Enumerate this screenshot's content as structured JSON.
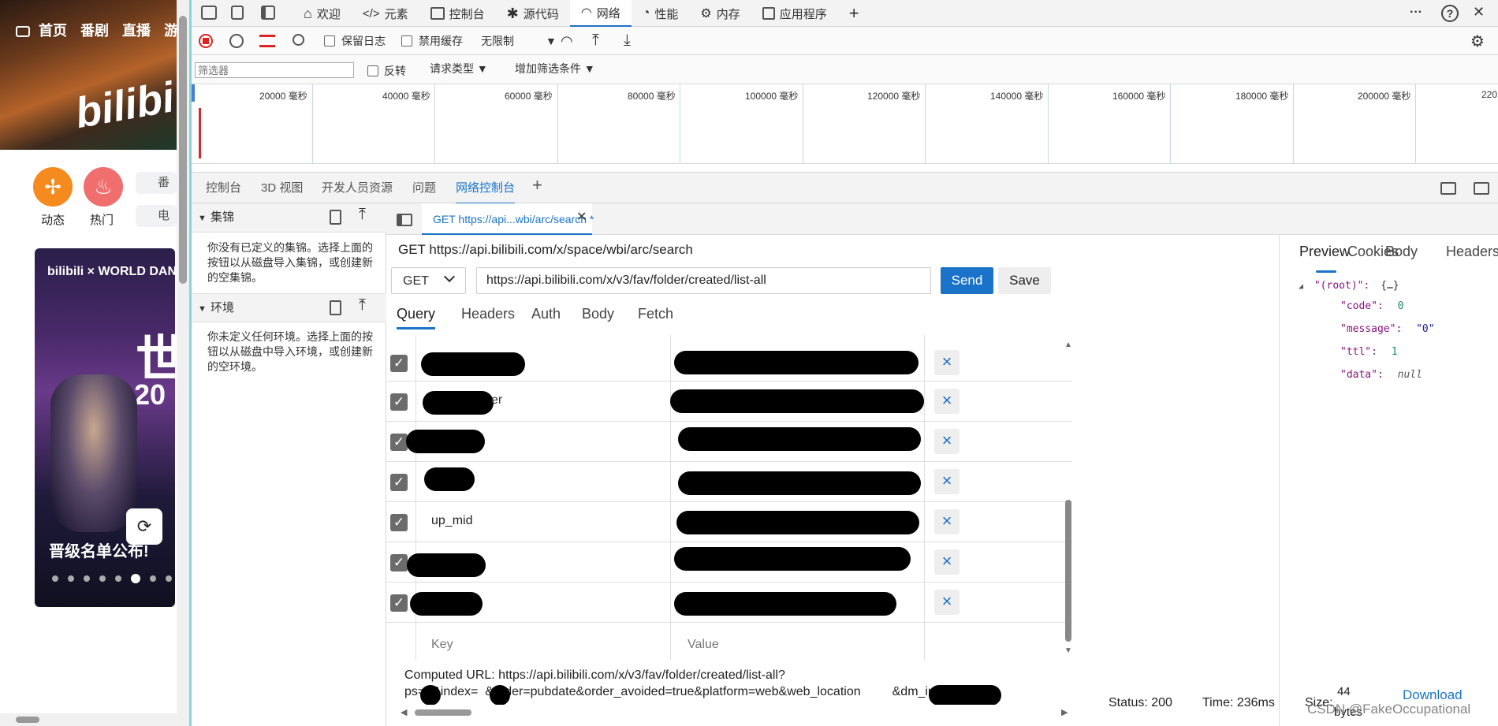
{
  "site": {
    "nav": [
      "首页",
      "番剧",
      "直播",
      "游戏"
    ],
    "logo": "bilibili",
    "quick": [
      {
        "label": "动态",
        "color": "#f58a1f"
      },
      {
        "label": "热门",
        "color": "#f06e6e"
      }
    ],
    "side_labels": [
      "番",
      "电"
    ],
    "banner_brand": "bilibili × WORLD DANCE",
    "banner_title": "晋级名单公布!",
    "banner_big": "世",
    "banner_year": "20"
  },
  "toolbar": {
    "tabs": [
      {
        "label": "欢迎",
        "icon": "home-icon"
      },
      {
        "label": "元素",
        "icon": "code-icon"
      },
      {
        "label": "控制台",
        "icon": "console-icon"
      },
      {
        "label": "源代码",
        "icon": "bug-icon"
      },
      {
        "label": "网络",
        "icon": "wifi-icon",
        "active": true
      },
      {
        "label": "性能",
        "icon": "gauge-icon"
      },
      {
        "label": "内存",
        "icon": "gear-icon"
      },
      {
        "label": "应用程序",
        "icon": "app-icon"
      }
    ],
    "add": "+",
    "more": "···",
    "help": "?",
    "close": "✕"
  },
  "network": {
    "preserve_log": "保留日志",
    "disable_cache": "禁用缓存",
    "throttle": "无限制",
    "filter_placeholder": "筛选器",
    "invert": "反转",
    "request_types": "请求类型",
    "more_filters": "增加筛选条件",
    "ticks": [
      "20000 毫秒",
      "40000 毫秒",
      "60000 毫秒",
      "80000 毫秒",
      "100000 毫秒",
      "120000 毫秒",
      "140000 毫秒",
      "160000 毫秒",
      "180000 毫秒",
      "200000 毫秒",
      "220"
    ]
  },
  "drawer": {
    "tabs": [
      "控制台",
      "3D 视图",
      "开发人员资源",
      "问题",
      "网络控制台"
    ],
    "active": "网络控制台",
    "add": "+"
  },
  "sidebar": {
    "collections_title": "集锦",
    "collections_text": "你没有已定义的集锦。选择上面的按钮以从磁盘导入集锦，或创建新的空集锦。",
    "env_title": "环境",
    "env_text": "你未定义任何环境。选择上面的按钮以从磁盘中导入环境，或创建新的空环境。"
  },
  "request": {
    "tab_label": "GET https://api...wbi/arc/search *",
    "title": "GET https://api.bilibili.com/x/space/wbi/arc/search",
    "method": "GET",
    "url": "https://api.bilibili.com/x/v3/fav/folder/created/list-all",
    "send": "Send",
    "save": "Save",
    "tabs": [
      "Query",
      "Headers",
      "Auth",
      "Body",
      "Fetch"
    ],
    "active_tab": "Query",
    "params": [
      {
        "key": "",
        "partial": "",
        "checked": true
      },
      {
        "key": "",
        "partial": "er",
        "checked": true
      },
      {
        "key": "",
        "partial": "",
        "checked": true
      },
      {
        "key": "",
        "partial": "",
        "checked": true
      },
      {
        "key": "up_mid",
        "partial": "",
        "checked": true
      },
      {
        "key": "",
        "partial": "",
        "checked": true
      },
      {
        "key": "",
        "partial": "",
        "checked": true
      }
    ],
    "key_placeholder": "Key",
    "value_placeholder": "Value",
    "computed_label": "Computed URL: https://api.bilibili.com/x/v3/fav/folder/created/list-all?",
    "computed_line2": "ps=  &index=  &order=pubdate&order_avoided=true&platform=web&web_location         &dm_img_list"
  },
  "response": {
    "tabs": [
      "Preview",
      "Body",
      "Headers",
      "Cookies"
    ],
    "active_tab": "Preview",
    "root_key": "\"(root)\":",
    "root_val": "{…}",
    "fields": [
      {
        "key": "\"code\":",
        "val": "0",
        "type": "number"
      },
      {
        "key": "\"message\":",
        "val": "\"0\"",
        "type": "string"
      },
      {
        "key": "\"ttl\":",
        "val": "1",
        "type": "number"
      },
      {
        "key": "\"data\":",
        "val": "null",
        "type": "null"
      }
    ],
    "status": "Status: 200",
    "time": "Time: 236ms",
    "size_label": "Size:",
    "size_value": "44",
    "size_unit": "bytes",
    "download": "Download",
    "watermark": "CSDN @FakeOccupational"
  },
  "colors": {
    "accent": "#1a73c8",
    "send": "#1a73c8",
    "active_tab_underline": "#1a73c8"
  }
}
